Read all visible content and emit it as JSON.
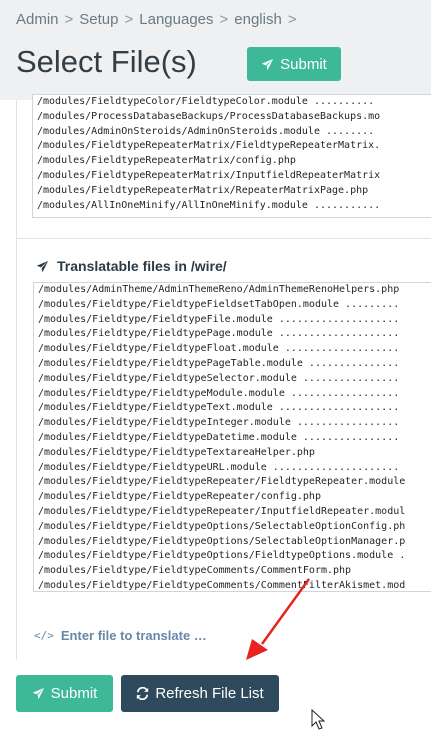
{
  "breadcrumb": [
    "Admin",
    "Setup",
    "Languages",
    "english"
  ],
  "page_title": "Select File(s)",
  "header_submit_label": "Submit",
  "site_files": [
    "/modules/FieldtypeColor/FieldtypeColor.module ..........",
    "/modules/ProcessDatabaseBackups/ProcessDatabaseBackups.mo",
    "/modules/AdminOnSteroids/AdminOnSteroids.module ........",
    "/modules/FieldtypeRepeaterMatrix/FieldtypeRepeaterMatrix.",
    "/modules/FieldtypeRepeaterMatrix/config.php",
    "/modules/FieldtypeRepeaterMatrix/InputfieldRepeaterMatrix",
    "/modules/FieldtypeRepeaterMatrix/RepeaterMatrixPage.php",
    "/modules/AllInOneMinify/AllInOneMinify.module ..........."
  ],
  "wire_section_label": "Translatable files in /wire/",
  "wire_files": [
    "/modules/AdminTheme/AdminThemeReno/AdminThemeRenoHelpers.php",
    "/modules/Fieldtype/FieldtypeFieldsetTabOpen.module .........",
    "/modules/Fieldtype/FieldtypeFile.module ....................",
    "/modules/Fieldtype/FieldtypePage.module ....................",
    "/modules/Fieldtype/FieldtypeFloat.module ...................",
    "/modules/Fieldtype/FieldtypePageTable.module ...............",
    "/modules/Fieldtype/FieldtypeSelector.module ................",
    "/modules/Fieldtype/FieldtypeModule.module ..................",
    "/modules/Fieldtype/FieldtypeText.module ....................",
    "/modules/Fieldtype/FieldtypeInteger.module .................",
    "/modules/Fieldtype/FieldtypeDatetime.module ................",
    "/modules/Fieldtype/FieldtypeTextareaHelper.php",
    "/modules/Fieldtype/FieldtypeURL.module .....................",
    "/modules/Fieldtype/FieldtypeRepeater/FieldtypeRepeater.module",
    "/modules/Fieldtype/FieldtypeRepeater/config.php",
    "/modules/Fieldtype/FieldtypeRepeater/InputfieldRepeater.modul",
    "/modules/Fieldtype/FieldtypeOptions/SelectableOptionConfig.ph",
    "/modules/Fieldtype/FieldtypeOptions/SelectableOptionManager.p",
    "/modules/Fieldtype/FieldtypeOptions/FieldtypeOptions.module .",
    "/modules/Fieldtype/FieldtypeComments/CommentForm.php",
    "/modules/Fieldtype/FieldtypeComments/CommentFilterAkismet.mod"
  ],
  "enter_file_label": "Enter file to translate …",
  "submit_label": "Submit",
  "refresh_label": "Refresh File List",
  "colors": {
    "accent_green": "#3eb998",
    "dark_button": "#2f4a5c",
    "annotation_arrow": "#e8231f",
    "link_blue": "#6688a7"
  },
  "icons": {
    "submit": "plane-icon",
    "section": "plane-icon",
    "enter_file": "code-icon",
    "refresh": "refresh-icon"
  }
}
